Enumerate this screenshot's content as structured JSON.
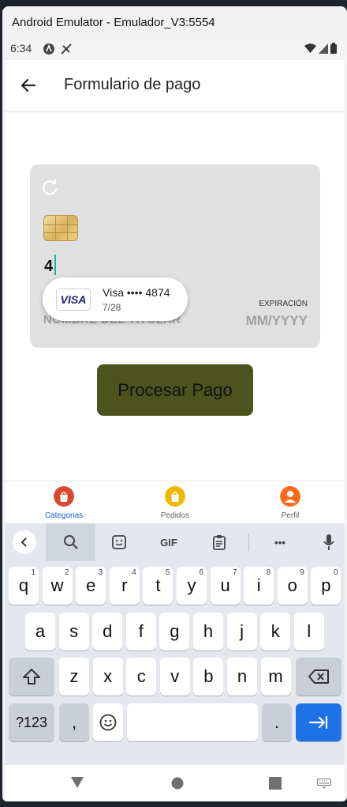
{
  "emulator": {
    "title": "Android Emulator - Emulador_V3:5554"
  },
  "status_bar": {
    "time": "6:34"
  },
  "app_bar": {
    "title": "Formulario de pago"
  },
  "card": {
    "number": "4",
    "holder_placeholder": "NOMBRE DEL TITULAR",
    "expiration_label": "EXPIRACIÓN",
    "expiration_placeholder": "MM/YYYY"
  },
  "autofill": {
    "brand": "VISA",
    "title": "Visa •••• 4874",
    "expiry": "7/28"
  },
  "process_button": {
    "label": "Procesar Pago"
  },
  "bottom_nav": {
    "items": [
      {
        "label": "Categorias",
        "icon": "shopping-bag-icon",
        "active": true,
        "color": "#d94a2b"
      },
      {
        "label": "Pedidos",
        "icon": "shopping-bag-icon",
        "active": false,
        "color": "#f2b705"
      },
      {
        "label": "Perfil",
        "icon": "person-icon",
        "active": false,
        "color": "#ff6b1a"
      }
    ]
  },
  "keyboard": {
    "toolbar": {
      "gif_label": "GIF",
      "more_label": "•••"
    },
    "rows": [
      [
        {
          "k": "q",
          "h": "1"
        },
        {
          "k": "w",
          "h": "2"
        },
        {
          "k": "e",
          "h": "3"
        },
        {
          "k": "r",
          "h": "4"
        },
        {
          "k": "t",
          "h": "5"
        },
        {
          "k": "y",
          "h": "6"
        },
        {
          "k": "u",
          "h": "7"
        },
        {
          "k": "i",
          "h": "8"
        },
        {
          "k": "o",
          "h": "9"
        },
        {
          "k": "p",
          "h": "0"
        }
      ],
      [
        {
          "k": "a"
        },
        {
          "k": "s"
        },
        {
          "k": "d"
        },
        {
          "k": "f"
        },
        {
          "k": "g"
        },
        {
          "k": "h"
        },
        {
          "k": "j"
        },
        {
          "k": "k"
        },
        {
          "k": "l"
        }
      ],
      [
        {
          "k": "z"
        },
        {
          "k": "x"
        },
        {
          "k": "c"
        },
        {
          "k": "v"
        },
        {
          "k": "b"
        },
        {
          "k": "n"
        },
        {
          "k": "m"
        }
      ]
    ],
    "symbols_label": "?123",
    "comma_label": ",",
    "period_label": "."
  },
  "colors": {
    "accent_blue": "#1d72e8",
    "button_olive": "#4d531f",
    "card_grey": "#e0e0e0",
    "cursor_teal": "#19b39a"
  }
}
